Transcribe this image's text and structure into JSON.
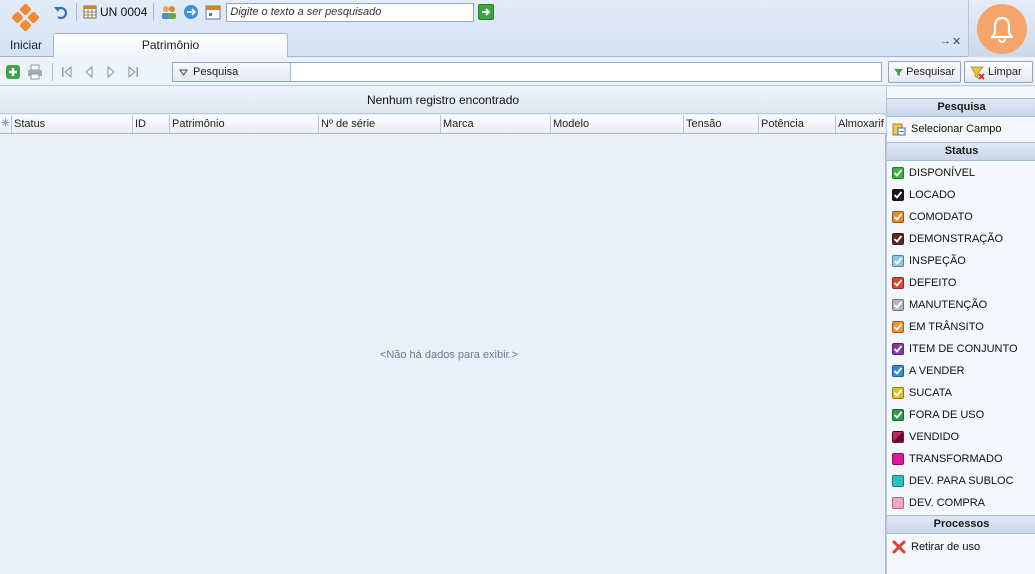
{
  "start": {
    "label": "Iniciar"
  },
  "toolbar": {
    "unit_label": "UN 0004",
    "search_placeholder": "Digite o texto a ser pesquisado"
  },
  "tab": {
    "label": "Patrimônio",
    "pin_glyph": "→",
    "close_glyph": "✕"
  },
  "actionbar": {
    "filter_field": "Pesquisa",
    "search_button": "Pesquisar",
    "clear_button": "Limpar"
  },
  "grid": {
    "header_message": "Nenhum registro encontrado",
    "columns": [
      "Status",
      "ID",
      "Patrimônio",
      "Nº de série",
      "Marca",
      "Modelo",
      "Tensão",
      "Potência",
      "Almoxarif"
    ],
    "empty_message": "<Não há dados para exibir.>"
  },
  "panel": {
    "search_title": "Pesquisa",
    "select_field": "Selecionar Campo",
    "status_title": "Status",
    "statuses": [
      {
        "label": "DISPONÍVEL",
        "color": "#3cb043"
      },
      {
        "label": "LOCADO",
        "color": "#1a1a1a"
      },
      {
        "label": "COMODATO",
        "color": "#e8892f"
      },
      {
        "label": "DEMONSTRAÇÃO",
        "color": "#5a2a22"
      },
      {
        "label": "INSPEÇÃO",
        "color": "#8fc7e8"
      },
      {
        "label": "DEFEITO",
        "color": "#e2452c"
      },
      {
        "label": "MANUTENÇÃO",
        "color": "#b5b5b5"
      },
      {
        "label": "EM TRÂNSITO",
        "color": "#f19232"
      },
      {
        "label": "ITEM DE CONJUNTO",
        "color": "#7d3ea3"
      },
      {
        "label": "A VENDER",
        "color": "#2f8fd6"
      },
      {
        "label": "SUCATA",
        "color": "#e2c128"
      },
      {
        "label": "FORA DE USO",
        "color": "#2e9a4e"
      },
      {
        "label": "VENDIDO",
        "color": "#8a2145"
      },
      {
        "label": "TRANSFORMADO",
        "color": "#e0169b"
      },
      {
        "label": "DEV. PARA SUBLOC",
        "color": "#2cc2c2"
      },
      {
        "label": "DEV. COMPRA",
        "color": "#f2a6c6"
      }
    ],
    "process_title": "Processos",
    "process_item": "Retirar de uso"
  }
}
